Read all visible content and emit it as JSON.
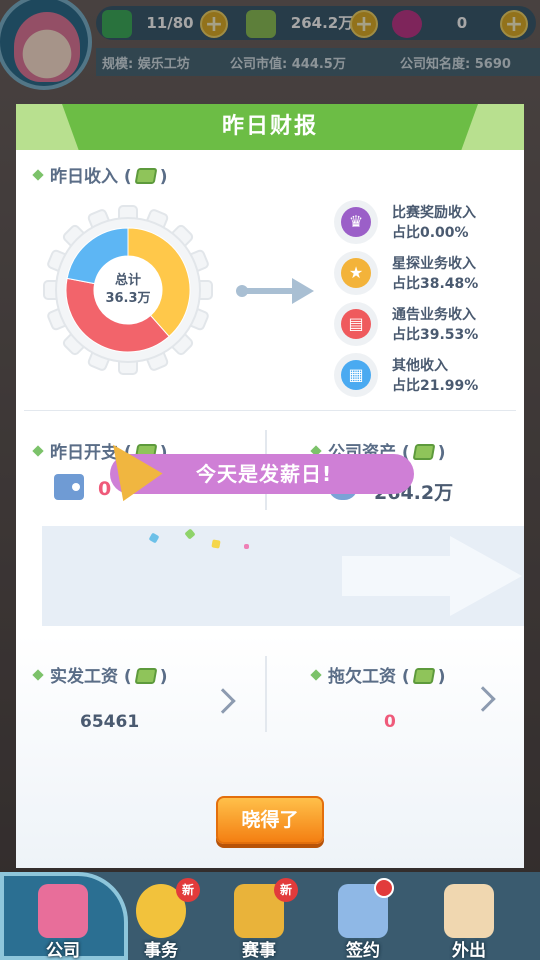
{
  "top_bar": {
    "energy": "11/80",
    "money": "264.2万",
    "gems": "0",
    "plus_symbol": "+",
    "scale": "规模: 娱乐工坊",
    "market_value": "公司市值: 444.5万",
    "reputation": "公司知名度: 5690"
  },
  "dialog": {
    "title": "昨日财报",
    "income": {
      "label": "昨日收入 (",
      "label_end": ")",
      "total_label": "总计",
      "total_value": "36.3万",
      "legend": [
        {
          "name": "比赛奖励收入",
          "pct": "占比0.00%",
          "icon": "trophy-icon",
          "color": "#9b5fc8"
        },
        {
          "name": "星探业务收入",
          "pct": "占比38.48%",
          "icon": "scout-star-icon",
          "color": "#f3b33a"
        },
        {
          "name": "通告业务收入",
          "pct": "占比39.53%",
          "icon": "clapperboard-icon",
          "color": "#ef5a5d"
        },
        {
          "name": "其他收入",
          "pct": "占比21.99%",
          "icon": "apps-grid-icon",
          "color": "#4aaaf1"
        }
      ]
    },
    "expense": {
      "label": "昨日开支 (",
      "label_end": ")",
      "value": "0"
    },
    "assets": {
      "label": "公司资产 (",
      "label_end": ")",
      "value": "264.2万",
      "bag_symbol": "¥"
    },
    "payday_text": "今天是发薪日!",
    "paid_wages": {
      "label": "实发工资 (",
      "label_end": ")",
      "value": "65461"
    },
    "owed_wages": {
      "label": "拖欠工资 (",
      "label_end": ")",
      "value": "0"
    },
    "ok_button": "晓得了"
  },
  "nav": {
    "items": [
      {
        "label": "公司",
        "icon": "company-icon"
      },
      {
        "label": "事务",
        "icon": "affairs-icon",
        "badge": "新"
      },
      {
        "label": "赛事",
        "icon": "tournament-icon",
        "badge": "新"
      },
      {
        "label": "签约",
        "icon": "contract-icon"
      },
      {
        "label": "外出",
        "icon": "door-exit-icon"
      }
    ]
  },
  "chart_data": {
    "type": "pie",
    "categories": [
      "比赛奖励收入",
      "星探业务收入",
      "通告业务收入",
      "其他收入"
    ],
    "values": [
      0.0,
      38.48,
      39.53,
      21.99
    ],
    "colors": [
      "#9b5fc8",
      "#ffc84a",
      "#f2646b",
      "#5db6f4"
    ],
    "center_label": "总计",
    "center_value": "36.3万"
  }
}
